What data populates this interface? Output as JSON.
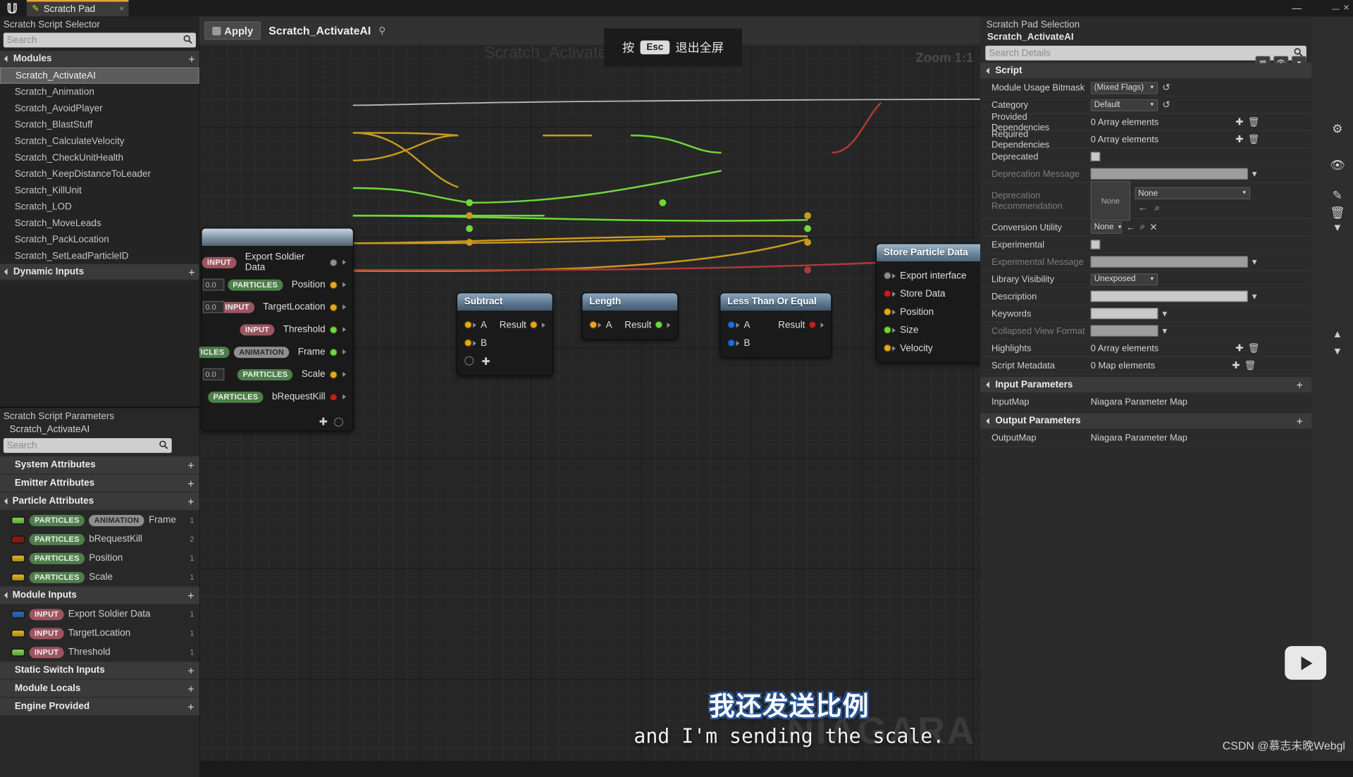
{
  "titlebar": {
    "tab_label": "Scratch Pad",
    "pencil_icon": "pencil-icon",
    "close_icon": "×",
    "minimize": "—",
    "maximize": "❐",
    "close": "✕"
  },
  "selector": {
    "title": "Scratch Script Selector",
    "search_placeholder": "Search",
    "sections": [
      {
        "name": "Modules",
        "expanded": true,
        "add_label": "+"
      },
      {
        "name": "Dynamic Inputs",
        "expanded": true,
        "add_label": "+"
      }
    ],
    "modules": [
      "Scratch_ActivateAI",
      "Scratch_Animation",
      "Scratch_AvoidPlayer",
      "Scratch_BlastStuff",
      "Scratch_CalculateVelocity",
      "Scratch_CheckUnitHealth",
      "Scratch_KeepDistanceToLeader",
      "Scratch_KillUnit",
      "Scratch_LOD",
      "Scratch_MoveLeads",
      "Scratch_PackLocation",
      "Scratch_SetLeadParticleID"
    ],
    "selected_module": "Scratch_ActivateAI"
  },
  "parameters": {
    "title": "Scratch Script Parameters",
    "subtitle": "Scratch_ActivateAI",
    "search_placeholder": "Search",
    "groups": [
      {
        "name": "System Attributes",
        "expanded": false,
        "items": []
      },
      {
        "name": "Emitter Attributes",
        "expanded": false,
        "items": []
      },
      {
        "name": "Particle Attributes",
        "expanded": true,
        "items": [
          {
            "color": "#7ed64a",
            "tags": [
              "PARTICLES",
              "ANIMATION"
            ],
            "label": "Frame",
            "count": "1"
          },
          {
            "color": "#a01010",
            "tags": [
              "PARTICLES"
            ],
            "label": "bRequestKill",
            "count": "2"
          },
          {
            "color": "#e0b820",
            "tags": [
              "PARTICLES"
            ],
            "label": "Position",
            "count": "1"
          },
          {
            "color": "#e0b820",
            "tags": [
              "PARTICLES"
            ],
            "label": "Scale",
            "count": "1"
          }
        ]
      },
      {
        "name": "Module Inputs",
        "expanded": true,
        "items": [
          {
            "color": "#2a68c8",
            "tags": [
              "INPUT"
            ],
            "label": "Export Soldier Data",
            "count": "1"
          },
          {
            "color": "#e0b820",
            "tags": [
              "INPUT"
            ],
            "label": "TargetLocation",
            "count": "1"
          },
          {
            "color": "#7ed64a",
            "tags": [
              "INPUT"
            ],
            "label": "Threshold",
            "count": "1"
          }
        ]
      },
      {
        "name": "Static Switch Inputs",
        "expanded": false,
        "items": []
      },
      {
        "name": "Module Locals",
        "expanded": false,
        "items": []
      },
      {
        "name": "Engine Provided",
        "expanded": false,
        "items": []
      }
    ]
  },
  "graph": {
    "apply_label": "Apply",
    "title": "Scratch_ActivateAI",
    "watermark": "Scratch_ActivateAI",
    "zoom_label": "Zoom 1:1",
    "niagara_watermark": "NIAGARA",
    "esc_hint": {
      "prefix": "按",
      "key": "Esc",
      "suffix": "退出全屏"
    },
    "nodes": [
      {
        "id": "map-get",
        "title": "",
        "pins": [
          {
            "tags": [
              "INPUT"
            ],
            "label": "Export Soldier Data",
            "color": "#8e8e8e",
            "value": ""
          },
          {
            "tags": [
              "PARTICLES"
            ],
            "label": "Position",
            "color": "#e8a818",
            "value": "0.0"
          },
          {
            "tags": [
              "INPUT"
            ],
            "label": "TargetLocation",
            "color": "#e8a818",
            "value": "0.0"
          },
          {
            "tags": [
              "INPUT"
            ],
            "label": "Threshold",
            "color": "#6fd83c",
            "value": ""
          },
          {
            "tags": [
              "PARTICLES",
              "ANIMATION"
            ],
            "label": "Frame",
            "color": "#6fd83c",
            "value": ""
          },
          {
            "tags": [
              "PARTICLES"
            ],
            "label": "Scale",
            "color": "#e8a818",
            "value": "0.0"
          },
          {
            "tags": [
              "PARTICLES"
            ],
            "label": "bRequestKill",
            "color": "#c02020",
            "value": ""
          }
        ]
      },
      {
        "id": "subtract",
        "title": "Subtract",
        "inputs": [
          {
            "label": "A",
            "color": "#e8a818"
          },
          {
            "label": "B",
            "color": "#e8a818"
          }
        ],
        "outputs": [
          {
            "label": "Result",
            "color": "#e8a818"
          }
        ]
      },
      {
        "id": "length",
        "title": "Length",
        "inputs": [
          {
            "label": "A",
            "color": "#e8a818"
          }
        ],
        "outputs": [
          {
            "label": "Result",
            "color": "#6fd83c"
          }
        ]
      },
      {
        "id": "less-than-or-equal",
        "title": "Less Than Or Equal",
        "inputs": [
          {
            "label": "A",
            "color": "#1f6ddd"
          },
          {
            "label": "B",
            "color": "#1f6ddd"
          }
        ],
        "outputs": [
          {
            "label": "Result",
            "color": "#c02020"
          }
        ]
      },
      {
        "id": "store-particle-data",
        "title": "Store Particle Data",
        "pins": [
          {
            "label": "Export interface",
            "color": "#8e8e8e"
          },
          {
            "label": "Store Data",
            "color": "#c02020"
          },
          {
            "label": "Position",
            "color": "#e8a818"
          },
          {
            "label": "Size",
            "color": "#6fd83c"
          },
          {
            "label": "Velocity",
            "color": "#e8a818"
          }
        ]
      }
    ]
  },
  "details": {
    "title": "Scratch Pad Selection",
    "subtitle": "Scratch_ActivateAI",
    "search_placeholder": "Search Details",
    "sections": [
      {
        "name": "Script",
        "rows": [
          {
            "label": "Module Usage Bitmask",
            "type": "combo",
            "value": "(Mixed Flags)",
            "has_reset": true
          },
          {
            "label": "Category",
            "type": "combo",
            "value": "Default",
            "has_reset": true
          },
          {
            "label": "Provided Dependencies",
            "type": "array",
            "value": "0 Array elements"
          },
          {
            "label": "Required Dependencies",
            "type": "array",
            "value": "0 Array elements"
          },
          {
            "label": "Deprecated",
            "type": "checkbox",
            "value": ""
          },
          {
            "label": "Deprecation Message",
            "type": "textbox",
            "value": "",
            "dim": true
          },
          {
            "label": "Deprecation Recommendation",
            "type": "asset",
            "value": "None",
            "dim": true
          },
          {
            "label": "Conversion Utility",
            "type": "combo-small",
            "value": "None"
          },
          {
            "label": "Experimental",
            "type": "checkbox",
            "value": ""
          },
          {
            "label": "Experimental Message",
            "type": "textbox",
            "value": "",
            "dim": true
          },
          {
            "label": "Library Visibility",
            "type": "combo",
            "value": "Unexposed"
          },
          {
            "label": "Description",
            "type": "textbox",
            "value": ""
          },
          {
            "label": "Keywords",
            "type": "textbox-short",
            "value": ""
          },
          {
            "label": "Collapsed View Format",
            "type": "textbox-short",
            "value": "",
            "dim": true
          },
          {
            "label": "Highlights",
            "type": "array",
            "value": "0 Array elements"
          },
          {
            "label": "Script Metadata",
            "type": "array",
            "value": "0 Map elements"
          }
        ]
      },
      {
        "name": "Input Parameters",
        "add_label": "+",
        "rows": [
          {
            "label": "InputMap",
            "type": "text",
            "value": "Niagara Parameter Map"
          }
        ]
      },
      {
        "name": "Output Parameters",
        "add_label": "+",
        "rows": [
          {
            "label": "OutputMap",
            "type": "text",
            "value": "Niagara Parameter Map"
          }
        ]
      }
    ]
  },
  "overlay": {
    "subtitle_cn": "我还发送比例",
    "subtitle_en": "and I'm sending the scale.",
    "credit": "CSDN @慕志未晚Webgl"
  }
}
